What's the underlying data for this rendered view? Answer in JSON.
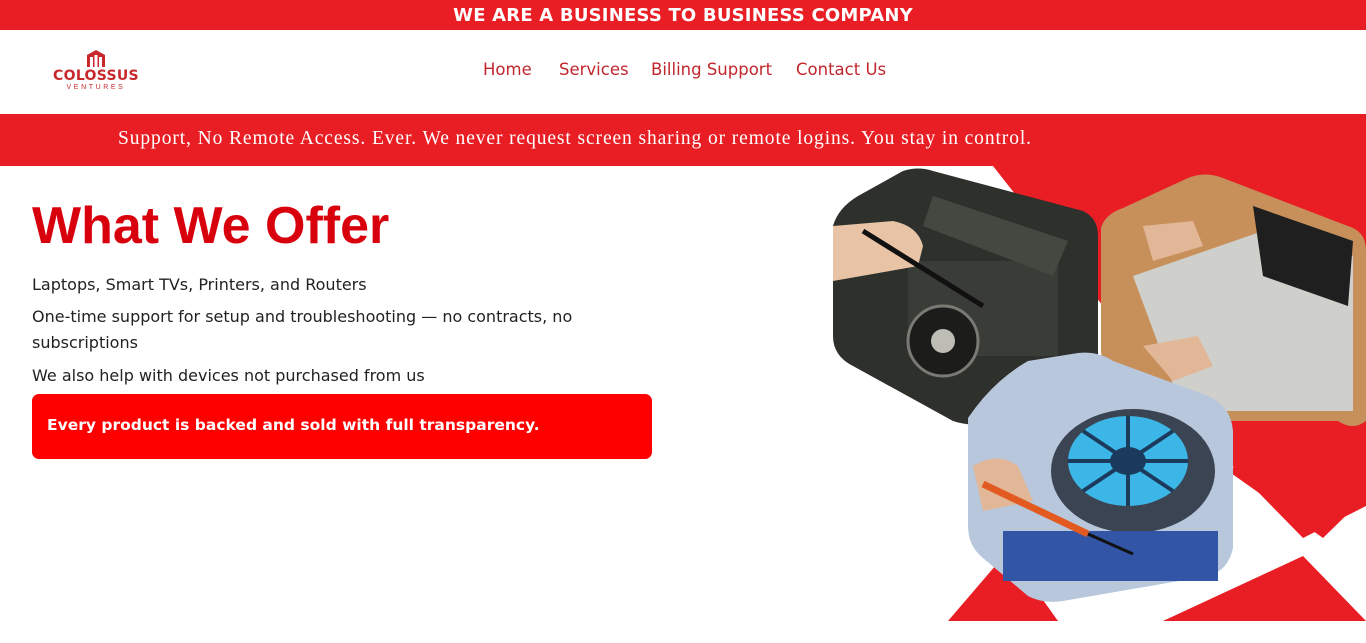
{
  "top_banner": {
    "text": "WE ARE A BUSINESS TO BUSINESS COMPANY"
  },
  "logo": {
    "name": "COLOSSUS",
    "sub": "VENTURES"
  },
  "nav": {
    "items": [
      "Home",
      "Services",
      "Billing Support",
      "Contact Us"
    ]
  },
  "ticker": {
    "text": "Support, No Remote Access. Ever. We never request screen sharing or remote logins. You stay in control."
  },
  "main": {
    "title": "What We Offer",
    "lines": [
      "Laptops, Smart TVs, Printers, and Routers",
      "One-time support for setup and troubleshooting — no contracts, no subscriptions",
      "We also help with devices not purchased from us"
    ],
    "notice": "Every product is backed and sold with full transparency."
  },
  "colors": {
    "brand_red": "#e91e24",
    "title_red": "#d9000d",
    "notice_red": "#ff0000",
    "nav_red": "#c1262c"
  },
  "icons": [
    "logo-mark-icon"
  ]
}
